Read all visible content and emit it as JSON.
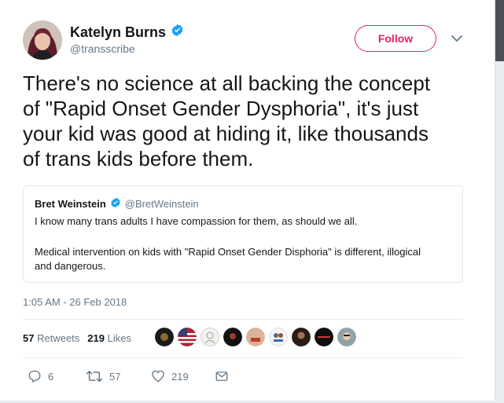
{
  "author": {
    "display_name": "Katelyn Burns",
    "handle": "@transscribe",
    "verified": true
  },
  "follow_label": "Follow",
  "tweet_lines": [
    "There's no science at all backing the concept",
    "of \"Rapid Onset Gender Dysphoria\", it's just",
    "your kid was good at hiding it, like thousands",
    "of trans kids before them."
  ],
  "quoted_tweet": {
    "display_name": "Bret Weinstein",
    "handle": "@BretWeinstein",
    "verified": true,
    "lines": [
      "I know many trans adults I have compassion for them, as should we all.",
      "Medical intervention on kids with \"Rapid Onset Gender Disphoria\" is different, illogical",
      "and dangerous."
    ]
  },
  "timestamp": "1:05 AM - 26 Feb 2018",
  "stats": {
    "retweets_count": "57",
    "retweets_label": "Retweets",
    "likes_count": "219",
    "likes_label": "Likes"
  },
  "liker_avatars": [
    "avatar-1",
    "avatar-2",
    "avatar-3",
    "avatar-4",
    "avatar-5",
    "avatar-6",
    "avatar-7",
    "avatar-8",
    "avatar-9"
  ],
  "actions": {
    "reply_count": "6",
    "retweet_count": "57",
    "like_count": "219"
  },
  "colors": {
    "follow": "#e0245e",
    "verified": "#1da1f2",
    "muted": "#657786",
    "text": "#14171a"
  }
}
